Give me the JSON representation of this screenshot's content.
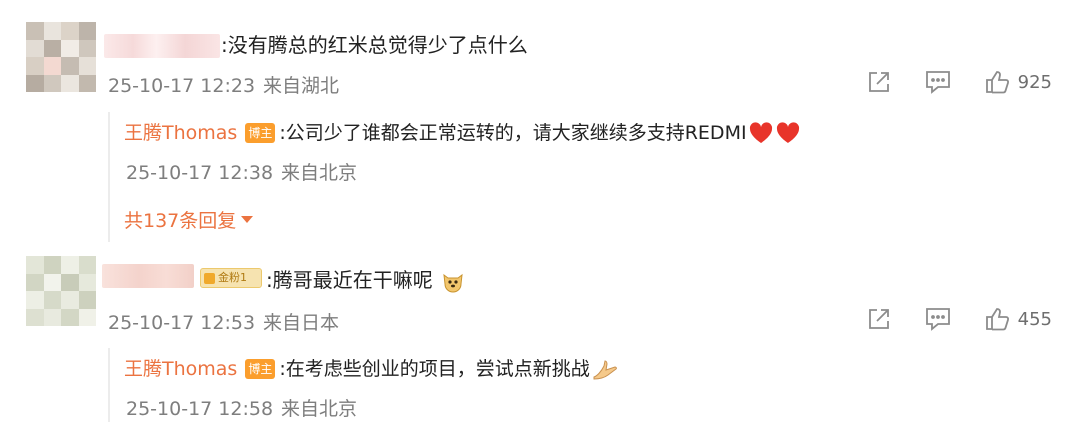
{
  "comments": [
    {
      "text": ":没有腾总的红米总觉得少了点什么",
      "time": "25-10-17 12:23",
      "location": "来自湖北",
      "likes": "925",
      "replies": [
        {
          "author": "王腾Thomas",
          "badge": "博主",
          "text": ":公司少了谁都会正常运转的，请大家继续多支持REDMI",
          "emoji": [
            "red-heart-icon",
            "red-heart-icon"
          ],
          "time": "25-10-17 12:38",
          "location": "来自北京"
        }
      ],
      "more_replies": "共137条回复"
    },
    {
      "fan_badge": "金粉1",
      "text": ":腾哥最近在干嘛呢",
      "emoji": [
        "doge-face-icon"
      ],
      "time": "25-10-17 12:53",
      "location": "来自日本",
      "likes": "455",
      "replies": [
        {
          "author": "王腾Thomas",
          "badge": "博主",
          "text": ":在考虑些创业的项目，尝试点新挑战",
          "emoji": [
            "praying-hands-icon"
          ],
          "time": "25-10-17 12:58",
          "location": "来自北京"
        }
      ]
    }
  ],
  "colors": {
    "accent": "#eb7340",
    "meta": "#7e7e7e",
    "host_badge": "#fb9e2d",
    "heart": "#e8342a"
  }
}
